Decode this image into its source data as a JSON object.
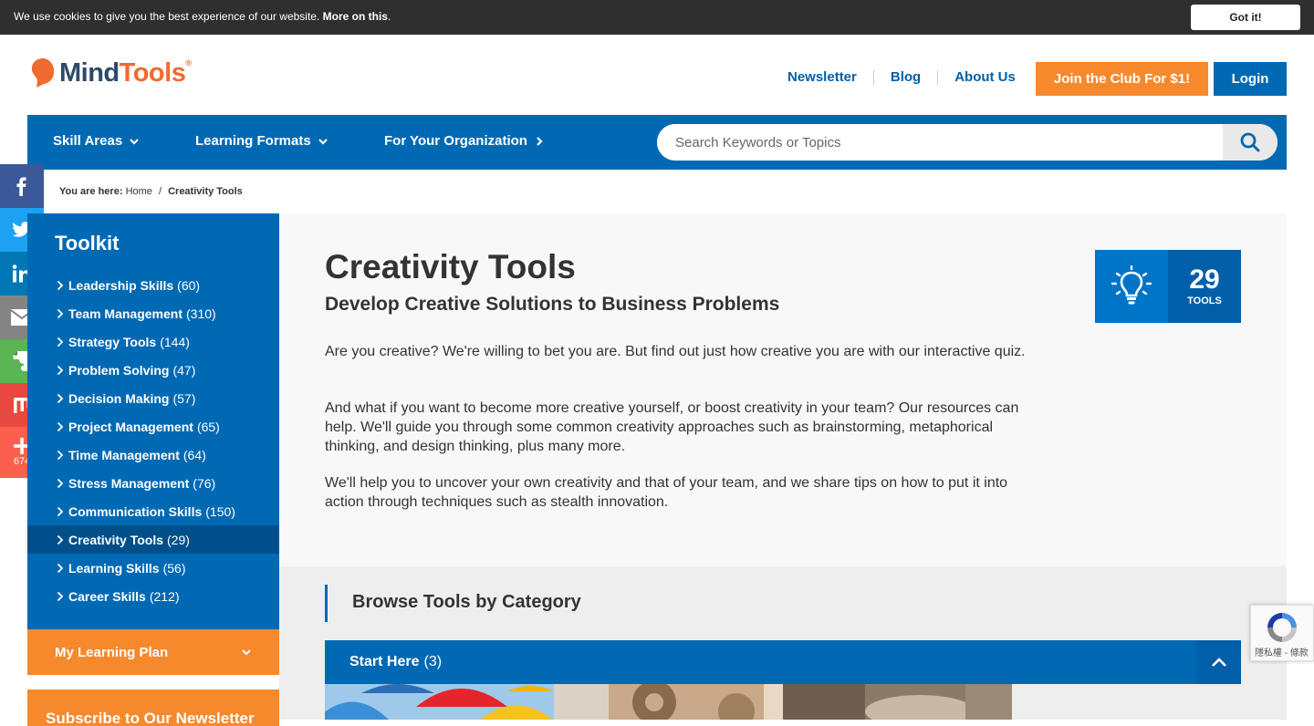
{
  "cookie": {
    "text": "We use cookies to give you the best experience of our website. ",
    "link": "More on this",
    "suffix": ".",
    "button": "Got it!"
  },
  "brand": {
    "mind": "Mind",
    "tools": "Tools",
    "reg": "®"
  },
  "header": {
    "links": [
      "Newsletter",
      "Blog",
      "About Us"
    ],
    "join_button": "Join the Club For $1!",
    "login_button": "Login"
  },
  "nav": {
    "items": [
      "Skill Areas",
      "Learning Formats",
      "For Your Organization"
    ],
    "search_placeholder": "Search Keywords or Topics"
  },
  "social": {
    "share_count": "674"
  },
  "breadcrumb": {
    "prefix": "You are here:",
    "home": "Home",
    "separator": "/",
    "current": "Creativity Tools"
  },
  "sidebar": {
    "title": "Toolkit",
    "items": [
      {
        "name": "Leadership Skills",
        "count": "(60)"
      },
      {
        "name": "Team Management",
        "count": "(310)"
      },
      {
        "name": "Strategy Tools",
        "count": "(144)"
      },
      {
        "name": "Problem Solving",
        "count": "(47)"
      },
      {
        "name": "Decision Making",
        "count": "(57)"
      },
      {
        "name": "Project Management",
        "count": "(65)"
      },
      {
        "name": "Time Management",
        "count": "(64)"
      },
      {
        "name": "Stress Management",
        "count": "(76)"
      },
      {
        "name": "Communication Skills",
        "count": "(150)"
      },
      {
        "name": "Creativity Tools",
        "count": "(29)"
      },
      {
        "name": "Learning Skills",
        "count": "(56)"
      },
      {
        "name": "Career Skills",
        "count": "(212)"
      }
    ],
    "active_index": 9,
    "learning_plan": "My Learning Plan",
    "newsletter": "Subscribe to Our Newsletter"
  },
  "main": {
    "title": "Creativity Tools",
    "subtitle": "Develop Creative Solutions to Business Problems",
    "paragraphs": [
      "Are you creative? We're willing to bet you are. But find out just how creative you are with our interactive quiz.",
      "And what if you want to become more creative yourself, or boost creativity in your team? Our resources can help. We'll guide you through some common creativity approaches such as brainstorming, metaphorical thinking, and design thinking, plus many more.",
      "We'll help you to uncover your own creativity and that of your team, and we share tips on how to put it into action through techniques such as stealth innovation."
    ],
    "badge": {
      "number": "29",
      "label": "TOOLS",
      "icon": "lightbulb-icon"
    }
  },
  "browse": {
    "title": "Browse Tools by Category",
    "section": {
      "name": "Start Here",
      "count": "(3)"
    }
  },
  "recaptcha": {
    "text": "隱私權 - 條款"
  },
  "colors": {
    "primary_blue": "#0069b4",
    "orange": "#f7892d",
    "dark_bar": "#2f2f2f",
    "text": "#333333"
  }
}
